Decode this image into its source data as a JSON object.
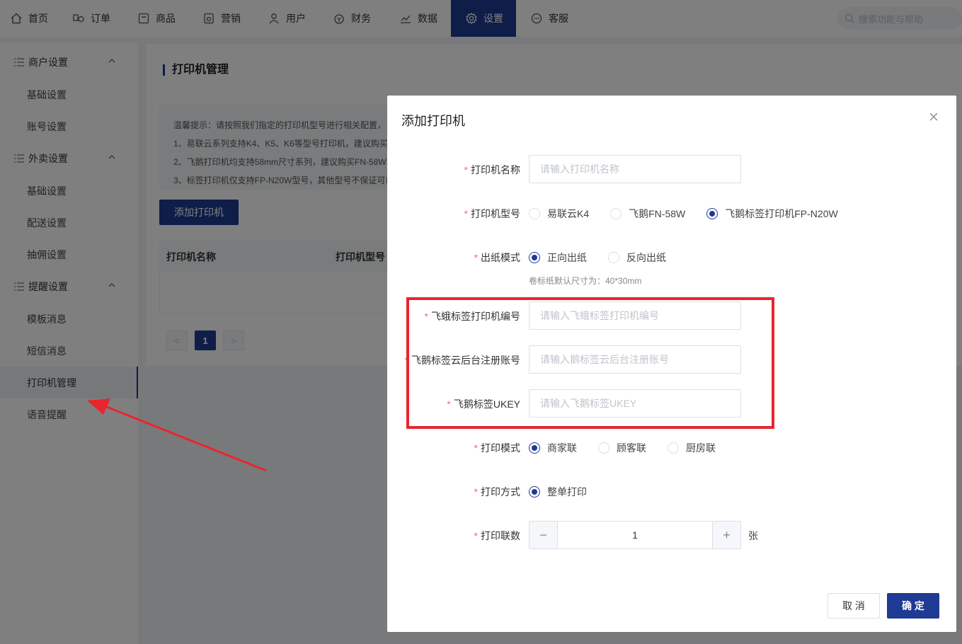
{
  "nav": {
    "items": [
      {
        "label": "首页",
        "icon": "home-icon"
      },
      {
        "label": "订单",
        "icon": "order-icon"
      },
      {
        "label": "商品",
        "icon": "goods-icon"
      },
      {
        "label": "营销",
        "icon": "marketing-icon"
      },
      {
        "label": "用户",
        "icon": "user-icon"
      },
      {
        "label": "财务",
        "icon": "finance-icon"
      },
      {
        "label": "数据",
        "icon": "chart-icon"
      },
      {
        "label": "设置",
        "icon": "gear-icon"
      },
      {
        "label": "客服",
        "icon": "service-icon"
      }
    ],
    "active": "设置",
    "search_placeholder": "搜索功能与帮助"
  },
  "sidebar": {
    "groups": [
      {
        "label": "商户设置",
        "items": [
          "基础设置",
          "账号设置"
        ]
      },
      {
        "label": "外卖设置",
        "items": [
          "基础设置",
          "配送设置",
          "抽佣设置"
        ]
      },
      {
        "label": "提醒设置",
        "items": [
          "模板消息",
          "短信消息",
          "打印机管理",
          "语音提醒"
        ]
      }
    ],
    "active_item": "打印机管理"
  },
  "page": {
    "title": "打印机管理",
    "tips": [
      "温馨提示：请按照我们指定的打印机型号进行相关配置，",
      "1、易联云系列支持K4、K5、K6等型号打印机，建议购买",
      "2、飞鹅打印机均支持58mm尺寸系列，建议购买FN-58W",
      "3、标签打印机仅支持FP-N20W型号，其他型号不保证可以"
    ],
    "add_button": "添加打印机",
    "table_headers": [
      "打印机名称",
      "打印机型号"
    ],
    "pager": {
      "prev": "<",
      "current": "1",
      "next": ">"
    }
  },
  "modal": {
    "title": "添加打印机",
    "fields": {
      "name": {
        "label": "打印机名称",
        "placeholder": "请输入打印机名称"
      },
      "model": {
        "label": "打印机型号",
        "options": [
          "易联云K4",
          "飞鹅FN-58W",
          "飞鹅标签打印机FP-N20W"
        ],
        "selected": "飞鹅标签打印机FP-N20W"
      },
      "paper_mode": {
        "label": "出纸模式",
        "options": [
          "正向出纸",
          "反向出纸"
        ],
        "selected": "正向出纸",
        "hint": "卷标纸默认尺寸为：40*30mm"
      },
      "serial": {
        "label": "飞蛾标签打印机编号",
        "placeholder": "请输入飞蛾标签打印机编号"
      },
      "account": {
        "label": "飞鹅标签云后台注册账号",
        "placeholder": "请输入鹅标签云后台注册账号"
      },
      "ukey": {
        "label": "飞鹅标签UKEY",
        "placeholder": "请输入飞鹅标签UKEY"
      },
      "print_mode": {
        "label": "打印模式",
        "options": [
          "商家联",
          "顾客联",
          "厨房联"
        ],
        "selected": "商家联"
      },
      "print_method": {
        "label": "打印方式",
        "options": [
          "整单打印"
        ],
        "selected": "整单打印"
      },
      "copies": {
        "label": "打印联数",
        "value": "1",
        "unit": "张",
        "minus": "−",
        "plus": "+"
      }
    },
    "cancel": "取 消",
    "confirm": "确 定"
  },
  "colors": {
    "brand": "#1f3a93",
    "annotation": "#e8252e",
    "required": "#f56c6c"
  }
}
